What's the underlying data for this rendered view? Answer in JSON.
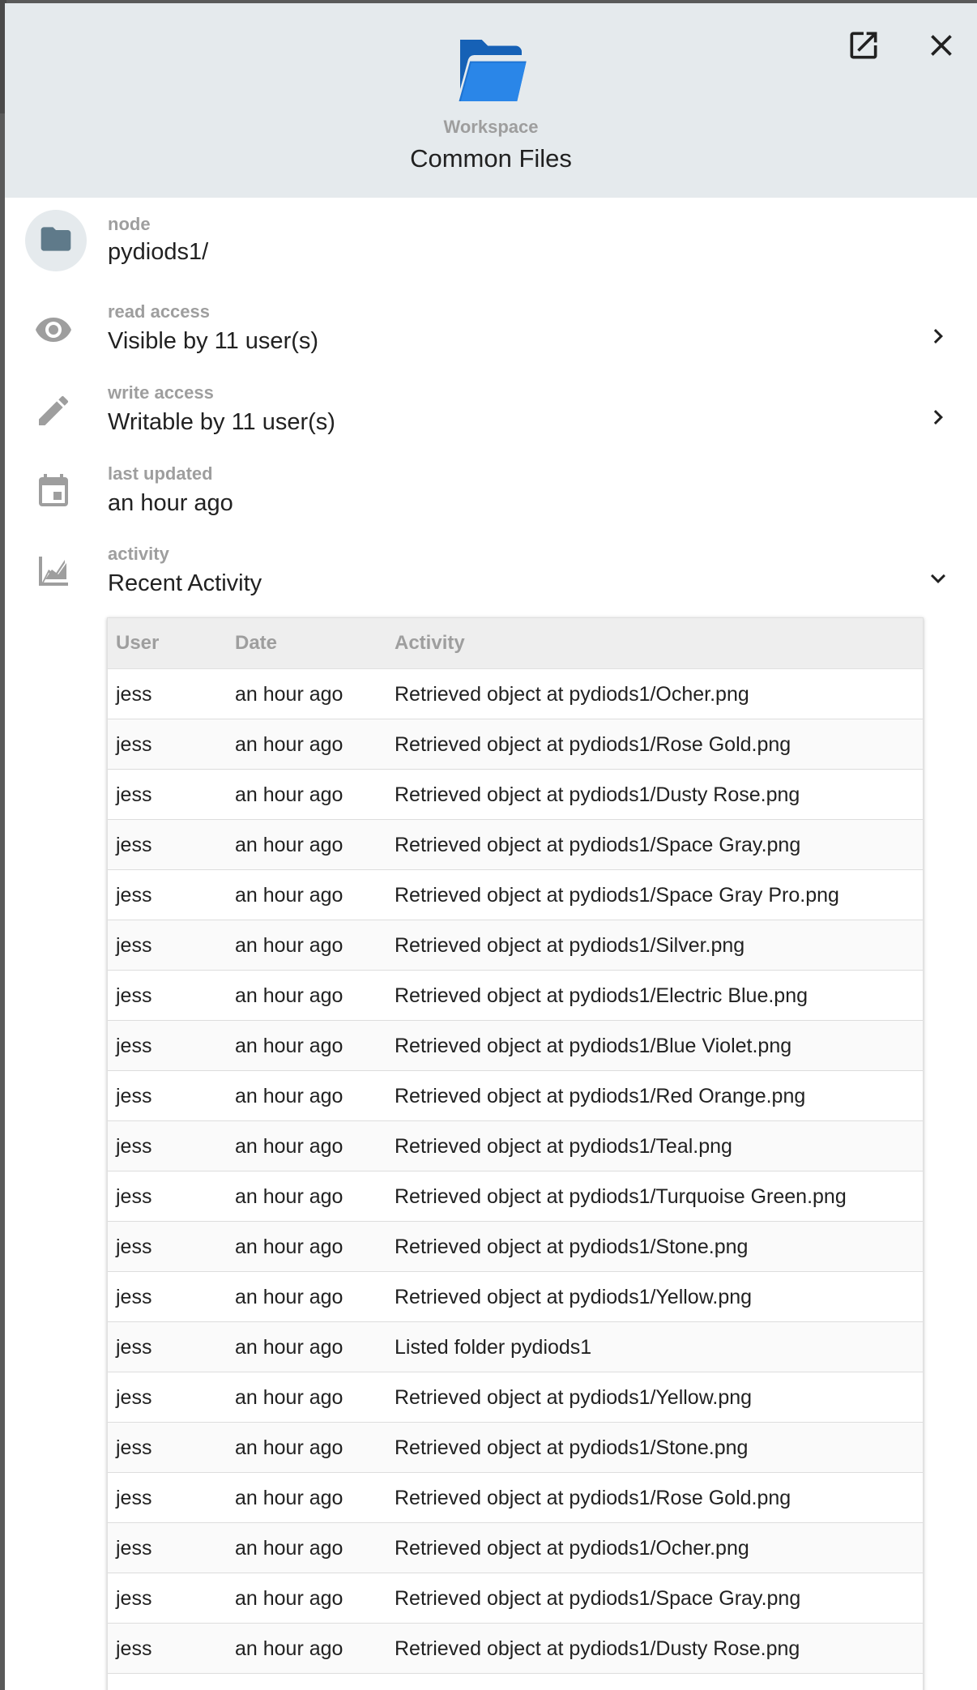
{
  "header": {
    "workspace_label": "Workspace",
    "workspace_title": "Common Files",
    "folder_color": "#1e73d2"
  },
  "details": {
    "node": {
      "label": "node",
      "value": "pydiods1/"
    },
    "read_access": {
      "label": "read access",
      "value": "Visible by 11 user(s)"
    },
    "write_access": {
      "label": "write access",
      "value": "Writable by 11 user(s)"
    },
    "last_updated": {
      "label": "last updated",
      "value": "an hour ago"
    },
    "activity": {
      "label": "activity",
      "value": "Recent Activity"
    }
  },
  "activity_table": {
    "columns": [
      "User",
      "Date",
      "Activity"
    ],
    "rows": [
      [
        "jess",
        "an hour ago",
        "Retrieved object at pydiods1/Ocher.png"
      ],
      [
        "jess",
        "an hour ago",
        "Retrieved object at pydiods1/Rose Gold.png"
      ],
      [
        "jess",
        "an hour ago",
        "Retrieved object at pydiods1/Dusty Rose.png"
      ],
      [
        "jess",
        "an hour ago",
        "Retrieved object at pydiods1/Space Gray.png"
      ],
      [
        "jess",
        "an hour ago",
        "Retrieved object at pydiods1/Space Gray Pro.png"
      ],
      [
        "jess",
        "an hour ago",
        "Retrieved object at pydiods1/Silver.png"
      ],
      [
        "jess",
        "an hour ago",
        "Retrieved object at pydiods1/Electric Blue.png"
      ],
      [
        "jess",
        "an hour ago",
        "Retrieved object at pydiods1/Blue Violet.png"
      ],
      [
        "jess",
        "an hour ago",
        "Retrieved object at pydiods1/Red Orange.png"
      ],
      [
        "jess",
        "an hour ago",
        "Retrieved object at pydiods1/Teal.png"
      ],
      [
        "jess",
        "an hour ago",
        "Retrieved object at pydiods1/Turquoise Green.png"
      ],
      [
        "jess",
        "an hour ago",
        "Retrieved object at pydiods1/Stone.png"
      ],
      [
        "jess",
        "an hour ago",
        "Retrieved object at pydiods1/Yellow.png"
      ],
      [
        "jess",
        "an hour ago",
        "Listed folder pydiods1"
      ],
      [
        "jess",
        "an hour ago",
        "Retrieved object at pydiods1/Yellow.png"
      ],
      [
        "jess",
        "an hour ago",
        "Retrieved object at pydiods1/Stone.png"
      ],
      [
        "jess",
        "an hour ago",
        "Retrieved object at pydiods1/Rose Gold.png"
      ],
      [
        "jess",
        "an hour ago",
        "Retrieved object at pydiods1/Ocher.png"
      ],
      [
        "jess",
        "an hour ago",
        "Retrieved object at pydiods1/Space Gray.png"
      ],
      [
        "jess",
        "an hour ago",
        "Retrieved object at pydiods1/Dusty Rose.png"
      ],
      [
        "",
        "",
        ""
      ]
    ]
  }
}
